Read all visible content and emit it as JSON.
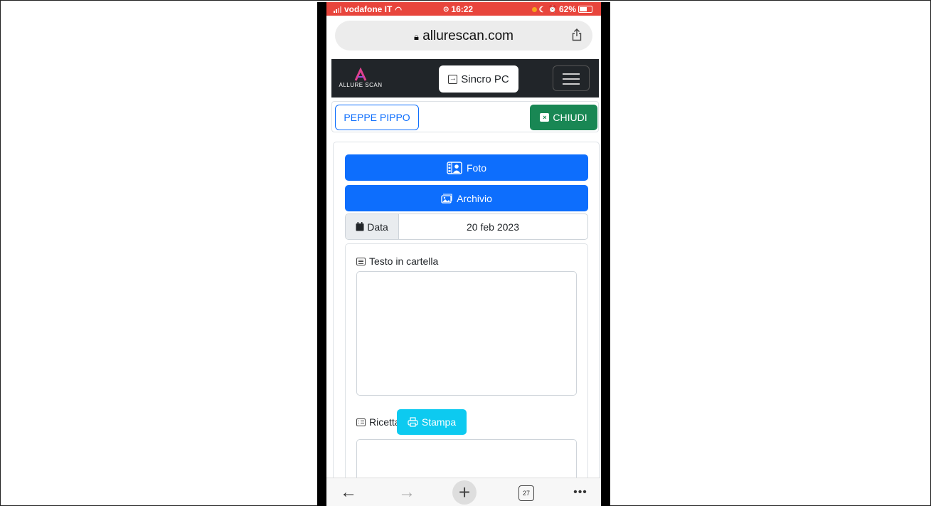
{
  "status_bar": {
    "carrier": "vodafone IT",
    "time": "16:22",
    "battery": "62%"
  },
  "browser": {
    "url": "allurescan.com",
    "tab_count": "27"
  },
  "navbar": {
    "logo_text": "ALLURE SCAN",
    "sync_label": "Sincro PC"
  },
  "user": {
    "name": "PEPPE PIPPO",
    "close_label": "CHIUDI"
  },
  "form": {
    "photo_label": "Foto",
    "archive_label": "Archivio",
    "date_label": "Data",
    "date_value": "20 feb 2023",
    "notes_label": "Testo in cartella",
    "recipe_label": "Ricetta",
    "print_label": "Stampa"
  },
  "colors": {
    "primary": "#0d6efd",
    "success": "#198754",
    "info": "#0dcaf0",
    "navbar": "#212529",
    "status_bar": "#e8453c"
  }
}
